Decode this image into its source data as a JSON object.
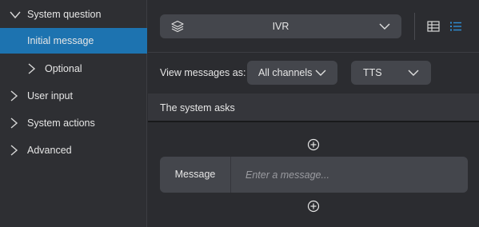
{
  "sidebar": {
    "items": [
      {
        "label": "System question",
        "expanded": true
      },
      {
        "label": "Initial message",
        "selected": true
      },
      {
        "label": "Optional",
        "expanded": false
      },
      {
        "label": "User input",
        "expanded": false
      },
      {
        "label": "System actions",
        "expanded": false
      },
      {
        "label": "Advanced",
        "expanded": false
      }
    ]
  },
  "toolbar": {
    "channel_value": "IVR",
    "view_table_icon": "table-view-icon",
    "view_list_icon": "list-view-icon"
  },
  "filters": {
    "view_label": "View messages as:",
    "channels_value": "All channels",
    "mode_value": "TTS"
  },
  "section": {
    "title": "The system asks"
  },
  "message": {
    "label": "Message",
    "value": "",
    "placeholder": "Enter a message..."
  },
  "colors": {
    "accent": "#1d73b0",
    "active_icon": "#2f8fd6",
    "background": "#2b2c30",
    "control": "#44464c"
  }
}
